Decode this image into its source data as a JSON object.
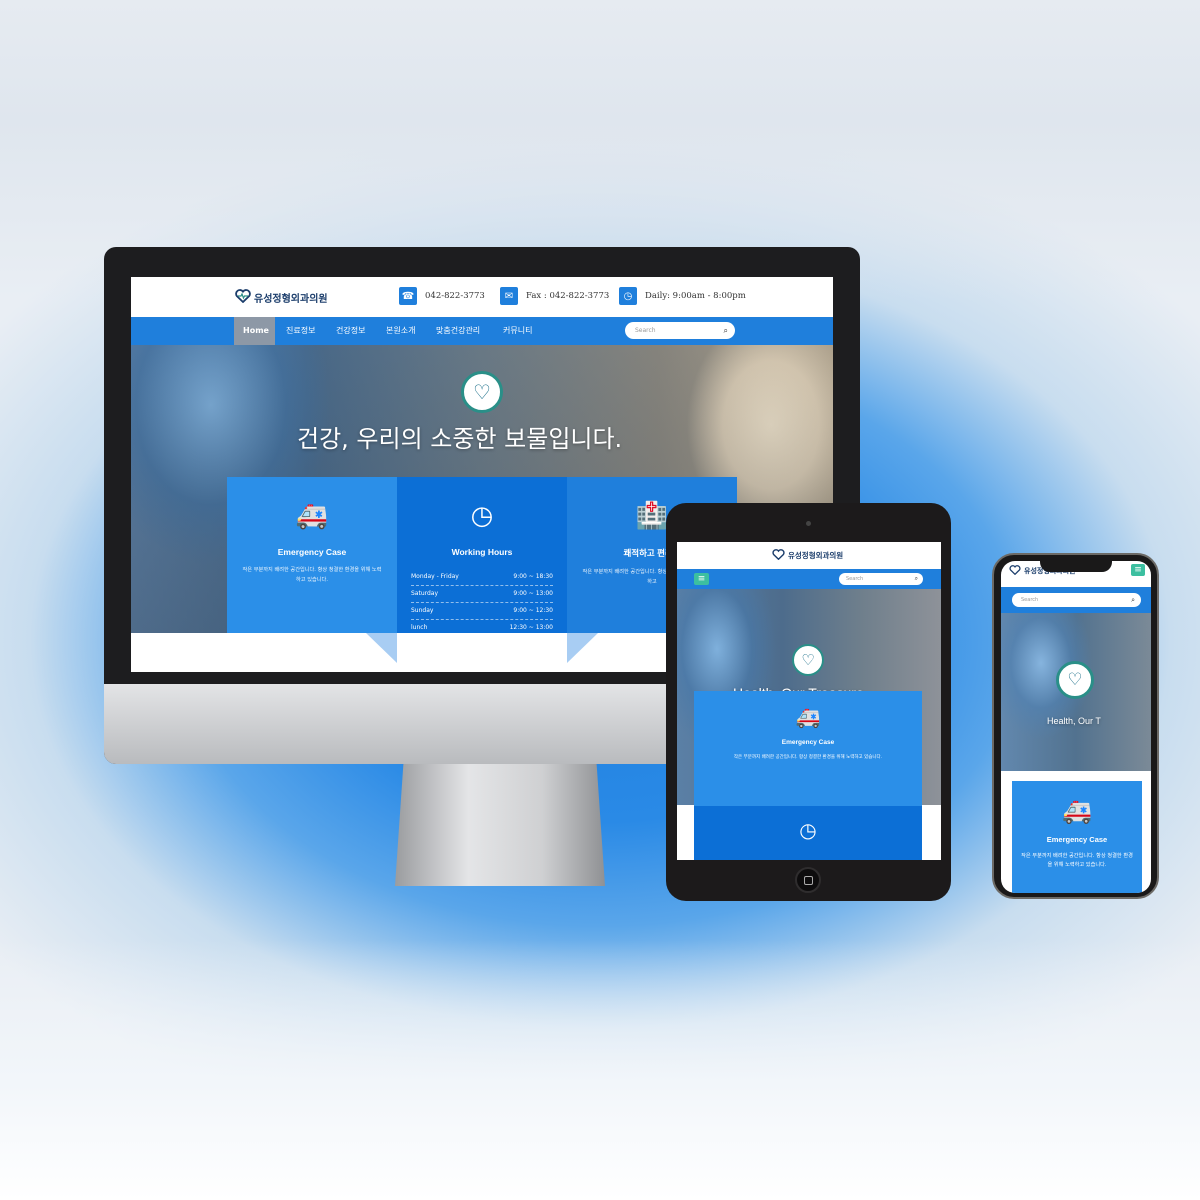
{
  "site": {
    "logo_text": "유성정형외과의원",
    "header": {
      "phone": "042-822-3773",
      "fax": "Fax : 042-822-3773",
      "hours": "Daily: 9:00am - 8:00pm"
    },
    "nav": [
      "Home",
      "진료정보",
      "건강정보",
      "본원소개",
      "맞춤건강관리",
      "커뮤니티"
    ],
    "search_placeholder": "Search",
    "hero_title_desktop": "건강, 우리의 소중한 보물입니다.",
    "hero_title_tablet": "Health, Our Treasure",
    "hero_title_phone": "Health, Our T"
  },
  "cards": {
    "emergency": {
      "title": "Emergency Case",
      "text": "작은 부분까지 배려한 공간입니다. 항상 청결한 환경을 위해 노력하고 있습니다."
    },
    "working_hours": {
      "title": "Working Hours",
      "rows": [
        {
          "day": "Monday - Friday",
          "time": "9:00 ~ 18:30"
        },
        {
          "day": "Saturday",
          "time": "9:00 ~ 13:00"
        },
        {
          "day": "Sunday",
          "time": "9:00 ~ 12:30"
        },
        {
          "day": "lunch",
          "time": "12:30 ~ 13:00"
        }
      ]
    },
    "comfort": {
      "title": "쾌적하고 편리한",
      "text": "작은 부분까지 배려한 공간입니다. 항상 청결한 환경을 위해 노력하고"
    }
  },
  "icons": {
    "logo": "heart-pulse-icon",
    "phone": "phone-icon",
    "fax": "envelope-icon",
    "hours": "clock-icon",
    "search": "search-icon",
    "menu": "hamburger-menu-icon",
    "ambulance": "ambulance-icon",
    "clock": "clock-icon",
    "hospital": "hospital-building-icon"
  },
  "colors": {
    "brand_blue": "#1f7fdc",
    "card_light": "#2b8fe8",
    "card_dark": "#0c6fd6",
    "nav_active": "#8d98a6",
    "logo_navy": "#1b3d6b",
    "menu_button": "#3cbfa0"
  }
}
